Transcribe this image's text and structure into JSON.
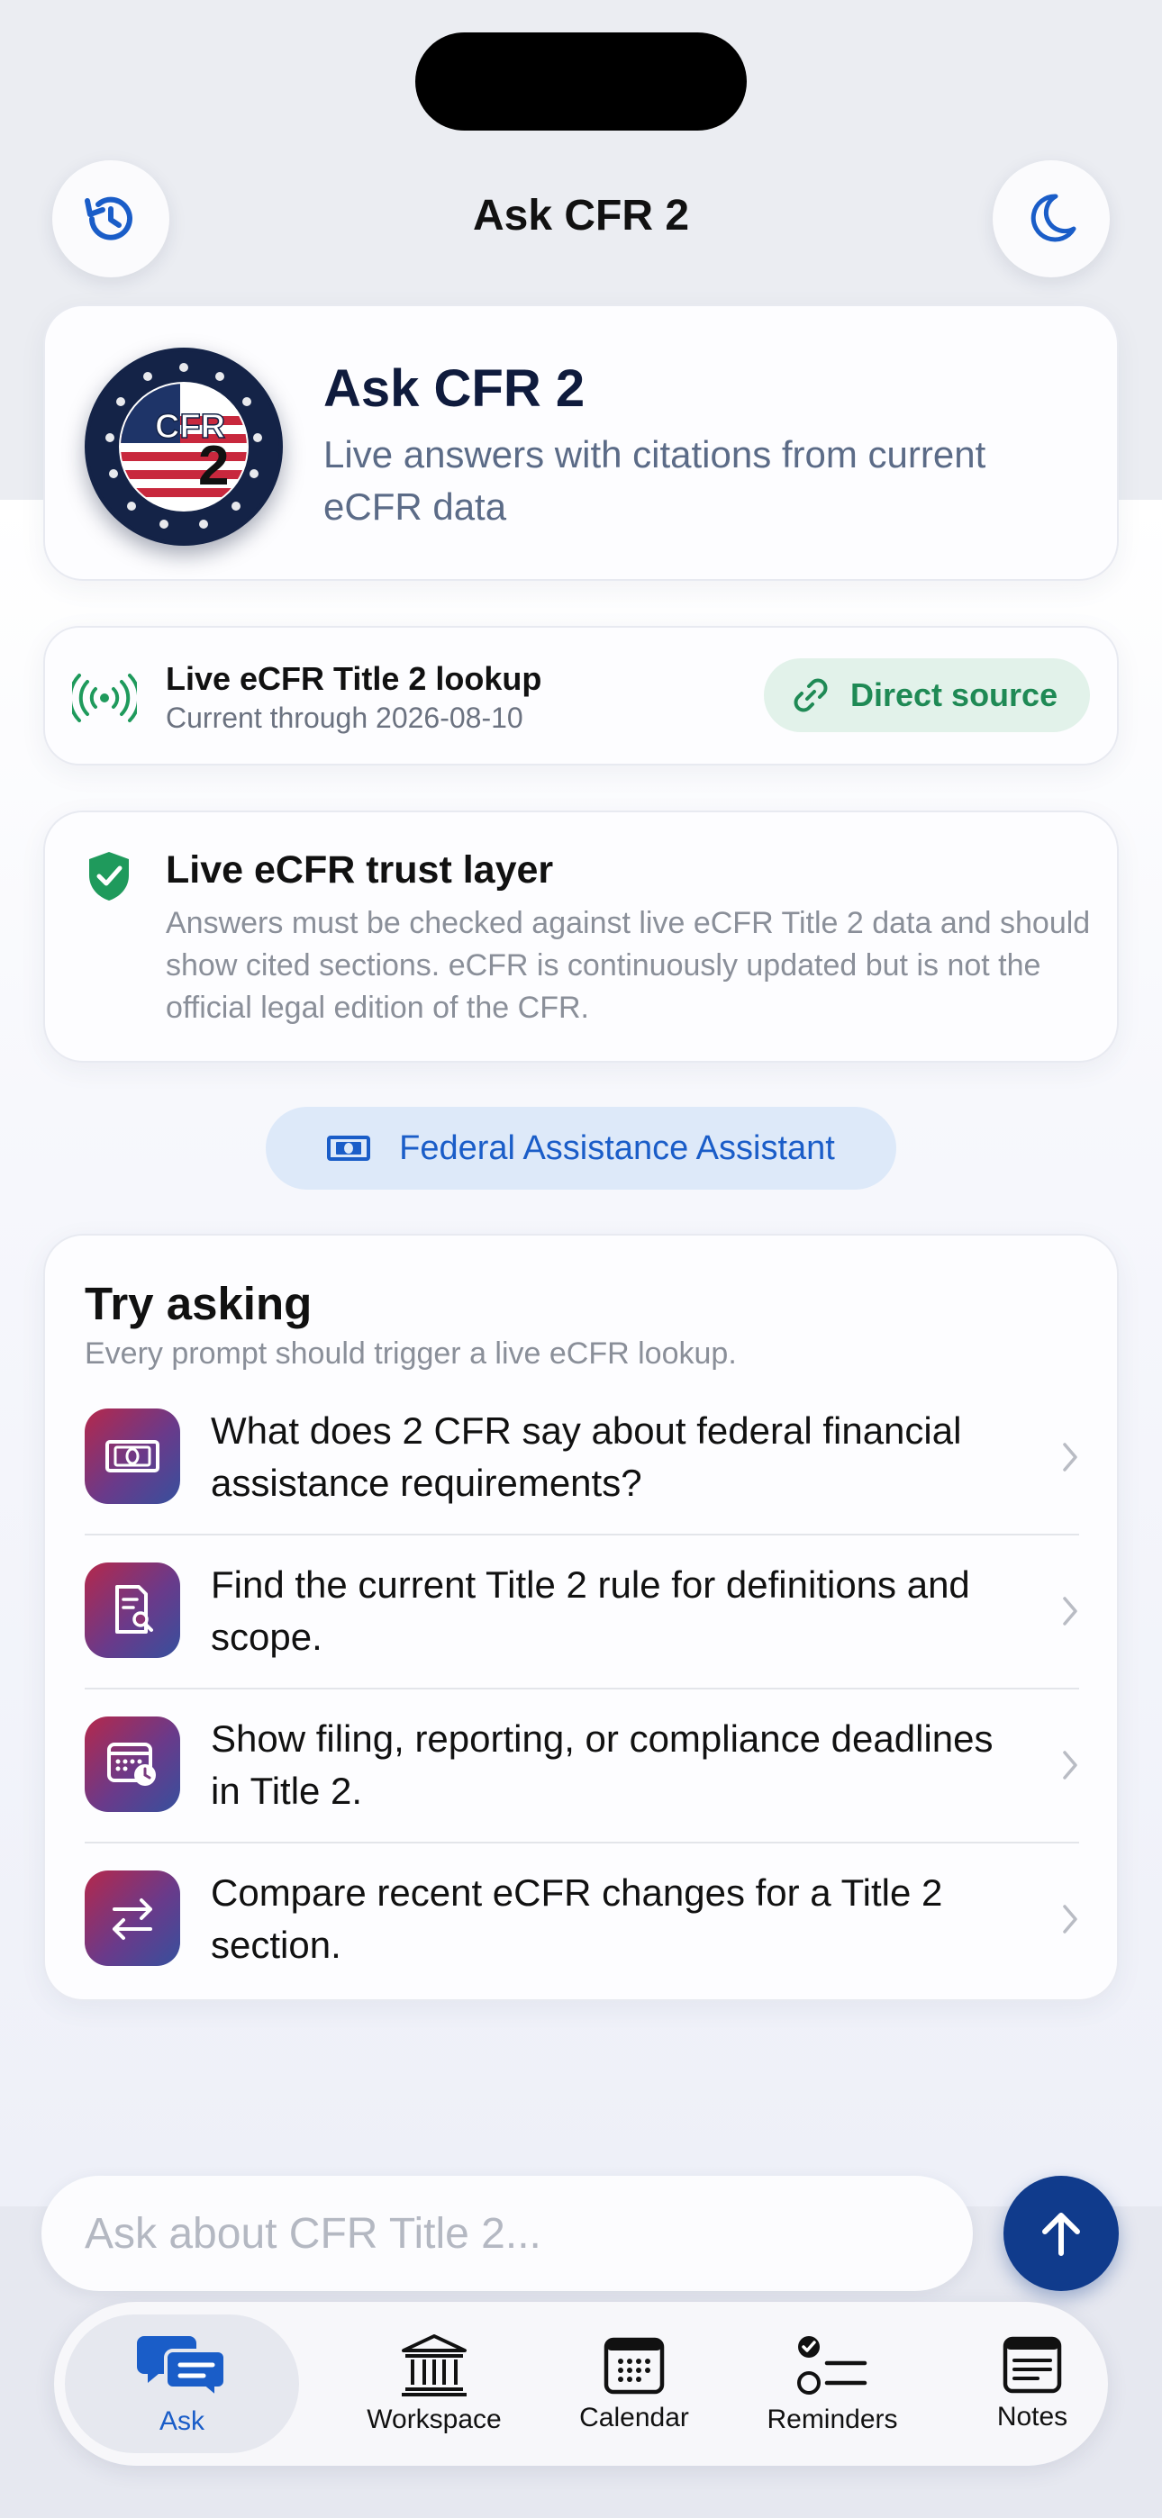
{
  "nav": {
    "title": "Ask CFR 2",
    "history_icon": "history-icon",
    "theme_icon": "moon-icon"
  },
  "hero": {
    "logo_text": "CFR",
    "logo_badge": "2",
    "title": "Ask CFR 2",
    "subtitle": "Live answers with citations from current eCFR data"
  },
  "lookup": {
    "title": "Live eCFR Title 2 lookup",
    "subtitle": "Current through 2026-08-10",
    "source_label": "Direct source"
  },
  "trust": {
    "title": "Live eCFR trust layer",
    "body": "Answers must be checked against live eCFR Title 2 data and should show cited sections. eCFR is continuously updated but is not the official legal edition of the CFR."
  },
  "assistant": {
    "label": "Federal Assistance Assistant"
  },
  "try_asking": {
    "title": "Try asking",
    "subtitle": "Every prompt should trigger a live eCFR lookup.",
    "prompts": [
      {
        "text": "What does 2 CFR say about federal financial assistance requirements?",
        "icon": "banknote-icon"
      },
      {
        "text": "Find the current Title 2 rule for definitions and scope.",
        "icon": "document-search-icon"
      },
      {
        "text": "Show filing, reporting, or compliance deadlines in Title 2.",
        "icon": "calendar-clock-icon"
      },
      {
        "text": "Compare recent eCFR changes for a Title 2 section.",
        "icon": "compare-arrows-icon"
      }
    ]
  },
  "composer": {
    "placeholder": "Ask about CFR Title 2..."
  },
  "tabs": [
    {
      "label": "Ask",
      "icon": "chat-bubbles-icon"
    },
    {
      "label": "Workspace",
      "icon": "building-columns-icon"
    },
    {
      "label": "Calendar",
      "icon": "calendar-icon"
    },
    {
      "label": "Reminders",
      "icon": "checklist-icon"
    },
    {
      "label": "Notes",
      "icon": "notes-icon"
    }
  ],
  "colors": {
    "accent_blue": "#1a5dc8",
    "send_button": "#103b8c",
    "source_green": "#1f8a55",
    "shield_green": "#1f9a5c"
  }
}
